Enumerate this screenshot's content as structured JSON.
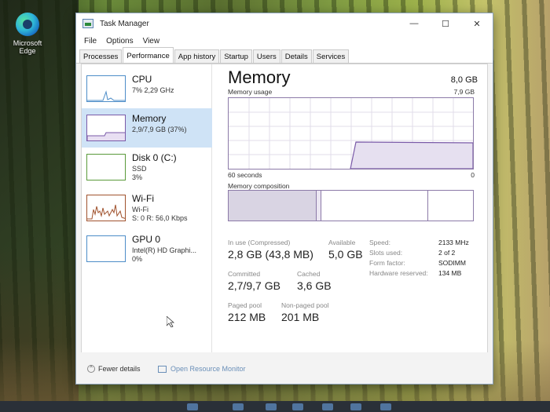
{
  "desktop": {
    "edge_label": "Microsoft Edge"
  },
  "window": {
    "title": "Task Manager",
    "controls": {
      "minimize": "—",
      "maximize": "☐",
      "close": "✕"
    },
    "menu": [
      "File",
      "Options",
      "View"
    ],
    "tabs": [
      "Processes",
      "Performance",
      "App history",
      "Startup",
      "Users",
      "Details",
      "Services"
    ],
    "active_tab": "Performance"
  },
  "resources": [
    {
      "name": "CPU",
      "sub1": "7%  2,29 GHz",
      "sub2": ""
    },
    {
      "name": "Memory",
      "sub1": "2,9/7,9 GB (37%)",
      "sub2": ""
    },
    {
      "name": "Disk 0 (C:)",
      "sub1": "SSD",
      "sub2": "3%"
    },
    {
      "name": "Wi-Fi",
      "sub1": "Wi-Fi",
      "sub2": "S: 0  R: 56,0 Kbps"
    },
    {
      "name": "GPU 0",
      "sub1": "Intel(R) HD Graphi...",
      "sub2": "0%"
    }
  ],
  "memory": {
    "title": "Memory",
    "total": "8,0 GB",
    "usage_label": "Memory usage",
    "usage_max": "7,9 GB",
    "time_left": "60 seconds",
    "time_right": "0",
    "composition_label": "Memory composition",
    "in_use_label": "In use (Compressed)",
    "in_use_value": "2,8 GB (43,8 MB)",
    "available_label": "Available",
    "available_value": "5,0 GB",
    "committed_label": "Committed",
    "committed_value": "2,7/9,7 GB",
    "cached_label": "Cached",
    "cached_value": "3,6 GB",
    "paged_label": "Paged pool",
    "paged_value": "212 MB",
    "nonpaged_label": "Non-paged pool",
    "nonpaged_value": "201 MB",
    "hardware": [
      {
        "label": "Speed:",
        "value": "2133 MHz"
      },
      {
        "label": "Slots used:",
        "value": "2 of 2"
      },
      {
        "label": "Form factor:",
        "value": "SODIMM"
      },
      {
        "label": "Hardware reserved:",
        "value": "134 MB"
      }
    ]
  },
  "footer": {
    "fewer_details": "Fewer details",
    "open_monitor": "Open Resource Monitor"
  }
}
